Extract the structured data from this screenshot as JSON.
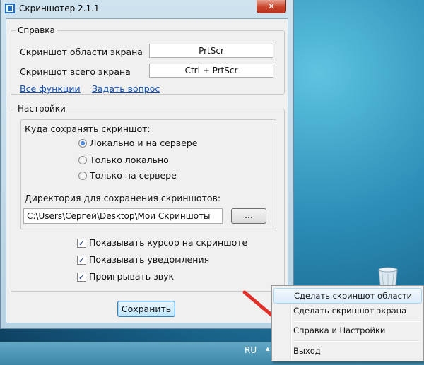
{
  "window": {
    "title": "Скриншотер 2.1.1",
    "close_label": "✕"
  },
  "help_group": {
    "legend": "Справка",
    "rows": [
      {
        "label": "Скриншот области экрана",
        "hotkey": "PrtScr"
      },
      {
        "label": "Скриншот всего экрана",
        "hotkey": "Ctrl + PrtScr"
      }
    ],
    "links": {
      "all_functions": "Все функции",
      "ask_question": "Задать вопрос"
    }
  },
  "settings_group": {
    "legend": "Настройки",
    "save_where": {
      "label": "Куда сохранять скриншот:",
      "options": [
        {
          "label": "Локально и на сервере",
          "checked": true
        },
        {
          "label": "Только локально",
          "checked": false
        },
        {
          "label": "Только на сервере",
          "checked": false
        }
      ]
    },
    "directory": {
      "label": "Директория для сохранения скриншотов:",
      "value": "C:\\Users\\Сергей\\Desktop\\Мои Скриншоты",
      "browse_label": "..."
    },
    "checkboxes": [
      {
        "label": "Показывать курсор на скриншоте",
        "checked": true
      },
      {
        "label": "Показывать уведомления",
        "checked": true
      },
      {
        "label": "Проигрывать звук",
        "checked": true
      }
    ]
  },
  "save_button": "Сохранить",
  "context_menu": {
    "items": [
      {
        "label": "Сделать скриншот области",
        "highlighted": true
      },
      {
        "label": "Сделать скриншот экрана",
        "highlighted": false
      },
      {
        "label": "Справка и Настройки",
        "highlighted": false
      },
      {
        "label": "Выход",
        "highlighted": false
      }
    ]
  },
  "taskbar": {
    "language": "RU",
    "tray_arrow": "▴"
  },
  "colors": {
    "link": "#0f4fb5",
    "arrow": "#e0302a",
    "close": "#c8442c"
  }
}
